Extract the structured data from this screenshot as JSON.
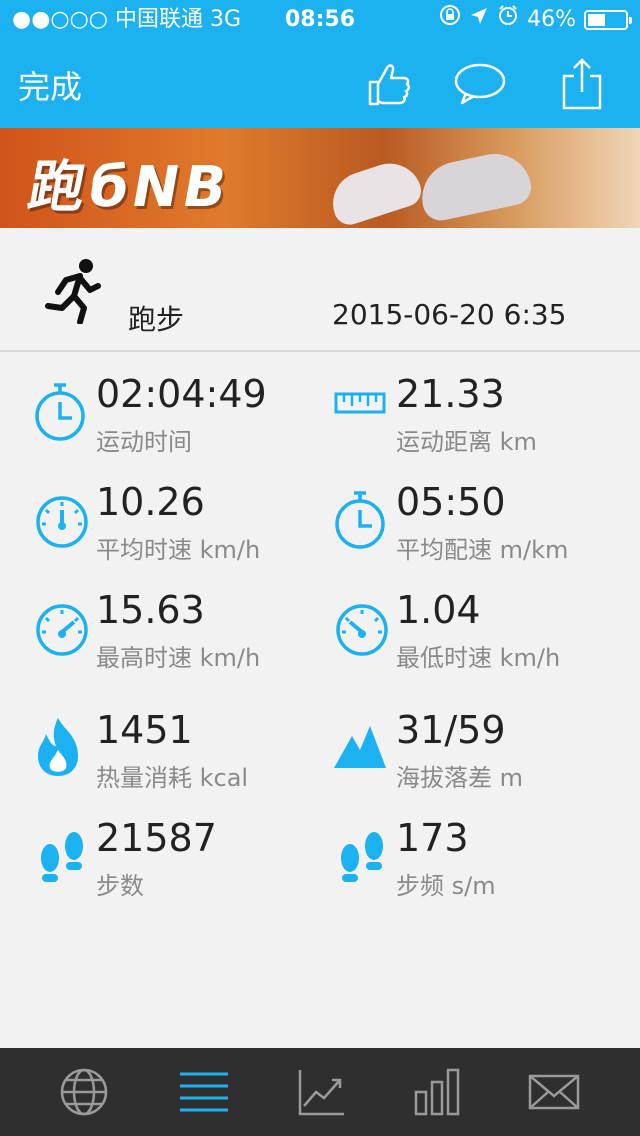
{
  "status_bar": {
    "carrier": "●●○○○ 中国联通  3G",
    "time": "08:56",
    "battery": "46%",
    "battery_level": 0.46
  },
  "navbar": {
    "done_label": "完成",
    "icons": [
      "like-icon",
      "comment-icon",
      "share-icon"
    ]
  },
  "banner": {
    "title": "跑бΝΒ",
    "image": "color-run-photo"
  },
  "activity": {
    "type": "跑步",
    "datetime": "2015-06-20 6:35",
    "icon": "runner-icon"
  },
  "stats": [
    {
      "value": "02:04:49",
      "label": "运动时间",
      "icon": "stopwatch-icon"
    },
    {
      "value": "21.33",
      "label": "运动距离 km",
      "icon": "ruler-icon"
    },
    {
      "value": "10.26",
      "label": "平均时速 km/h",
      "icon": "speedometer-icon"
    },
    {
      "value": "05:50",
      "label": "平均配速 m/km",
      "icon": "stopwatch-icon"
    },
    {
      "value": "15.63",
      "label": "最高时速 km/h",
      "icon": "speedometer-high-icon"
    },
    {
      "value": "1.04",
      "label": "最低时速 km/h",
      "icon": "speedometer-low-icon"
    },
    {
      "value": "1451",
      "label": "热量消耗 kcal",
      "icon": "flame-icon"
    },
    {
      "value": "31/59",
      "label": "海拔落差 m",
      "icon": "mountain-icon"
    },
    {
      "value": "21587",
      "label": "步数",
      "icon": "footprints-icon"
    },
    {
      "value": "173",
      "label": "步频 s/m",
      "icon": "footprints-icon"
    }
  ],
  "tabbar": {
    "tabs": [
      "globe-icon",
      "list-icon",
      "trend-chart-icon",
      "bar-chart-icon",
      "mail-icon"
    ],
    "active": 1
  },
  "colors": {
    "accent": "#1cb1f0",
    "tabbar": "#2f2f2f",
    "background": "#f2f2f2"
  }
}
